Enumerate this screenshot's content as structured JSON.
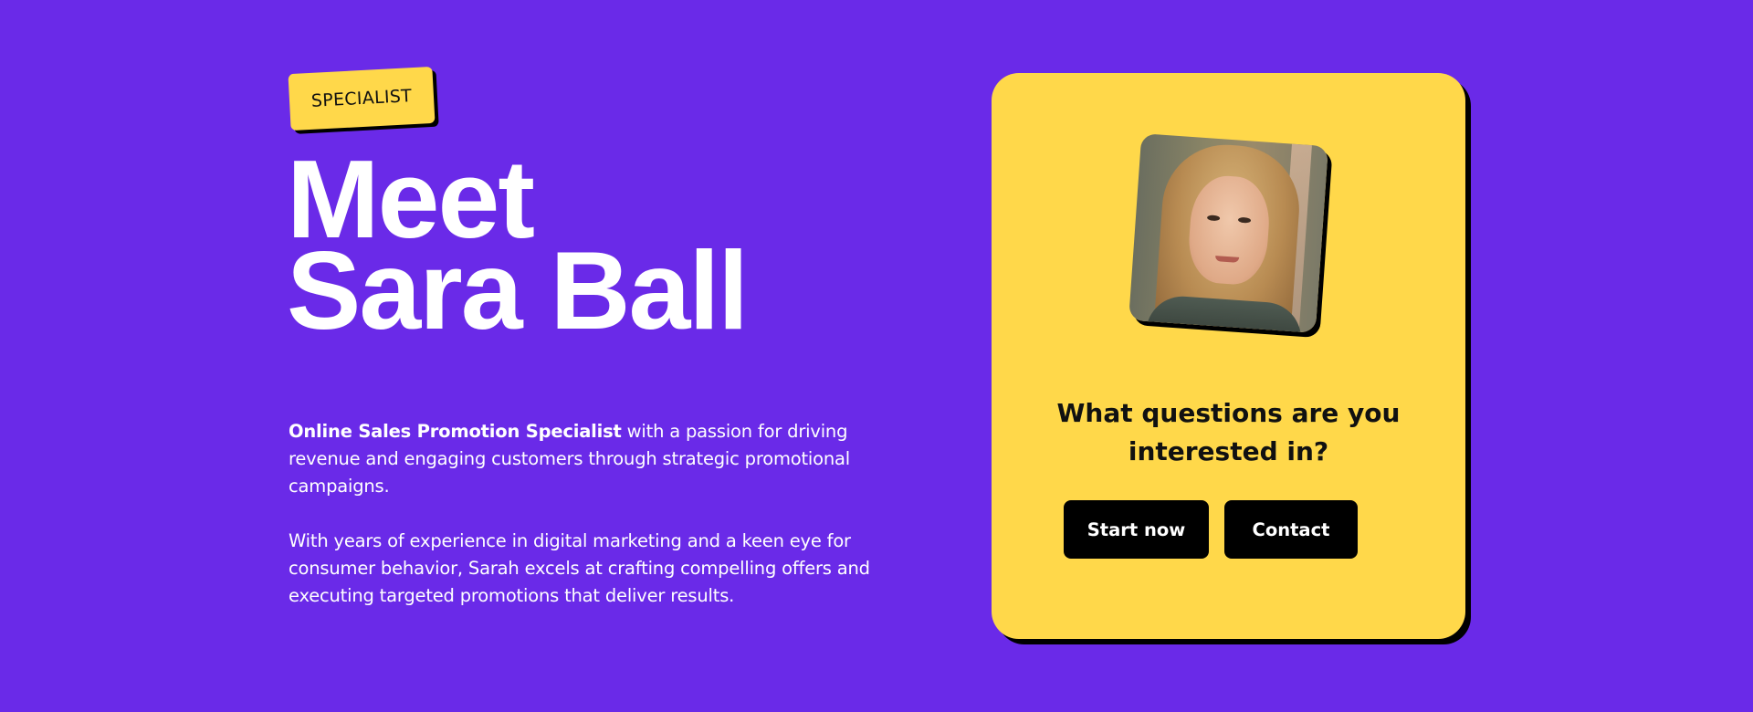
{
  "badge": {
    "label": "SPECIALIST"
  },
  "hero": {
    "title_line1": "Meet",
    "title_line2": "Sara Ball"
  },
  "bio": {
    "lead_strong": "Online Sales Promotion Specialist",
    "lead_rest": " with a passion for driving revenue and engaging customers through strategic promotional campaigns.",
    "paragraph2": "With years of experience in digital marketing and a keen eye for consumer behavior, Sarah excels at crafting compelling offers and executing targeted promotions that deliver results."
  },
  "card": {
    "question": "What questions are you interested in?",
    "start_label": "Start now",
    "contact_label": "Contact"
  },
  "colors": {
    "background": "#6a2ae8",
    "accent": "#ffd84a",
    "button": "#000000",
    "text_light": "#ffffff"
  }
}
